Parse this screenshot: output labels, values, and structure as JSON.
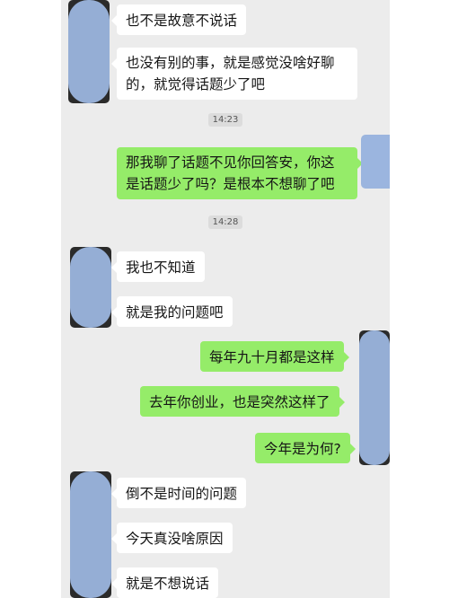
{
  "chat": {
    "messages": [
      {
        "side": "in",
        "text": "也不是故意不说话"
      },
      {
        "side": "in",
        "text_line1": "也没有别的事，就是感觉没啥好聊",
        "text_line2": "的，就觉得话题少了吧"
      },
      {
        "type": "time",
        "text": "14:23"
      },
      {
        "side": "out",
        "text_line1": "那我聊了话题不见你回答安，你这",
        "text_line2": "是话题少了吗？是根本不想聊了吧"
      },
      {
        "type": "time",
        "text": "14:28"
      },
      {
        "side": "in",
        "text": "我也不知道"
      },
      {
        "side": "in",
        "text": "就是我的问题吧"
      },
      {
        "side": "out",
        "text": "每年九十月都是这样"
      },
      {
        "side": "out",
        "text": "去年你创业，也是突然这样了"
      },
      {
        "side": "out",
        "text": "今年是为何?"
      },
      {
        "side": "in",
        "text": "倒不是时间的问题"
      },
      {
        "side": "in",
        "text": "今天真没啥原因"
      },
      {
        "side": "in",
        "text": "就是不想说话"
      }
    ]
  },
  "colors": {
    "outgoing_bubble": "#95ec69",
    "incoming_bubble": "#ffffff",
    "background": "#ececec",
    "scribble": "#9bb5de"
  },
  "icons": [
    "contact-avatar-icon",
    "self-avatar-icon"
  ]
}
